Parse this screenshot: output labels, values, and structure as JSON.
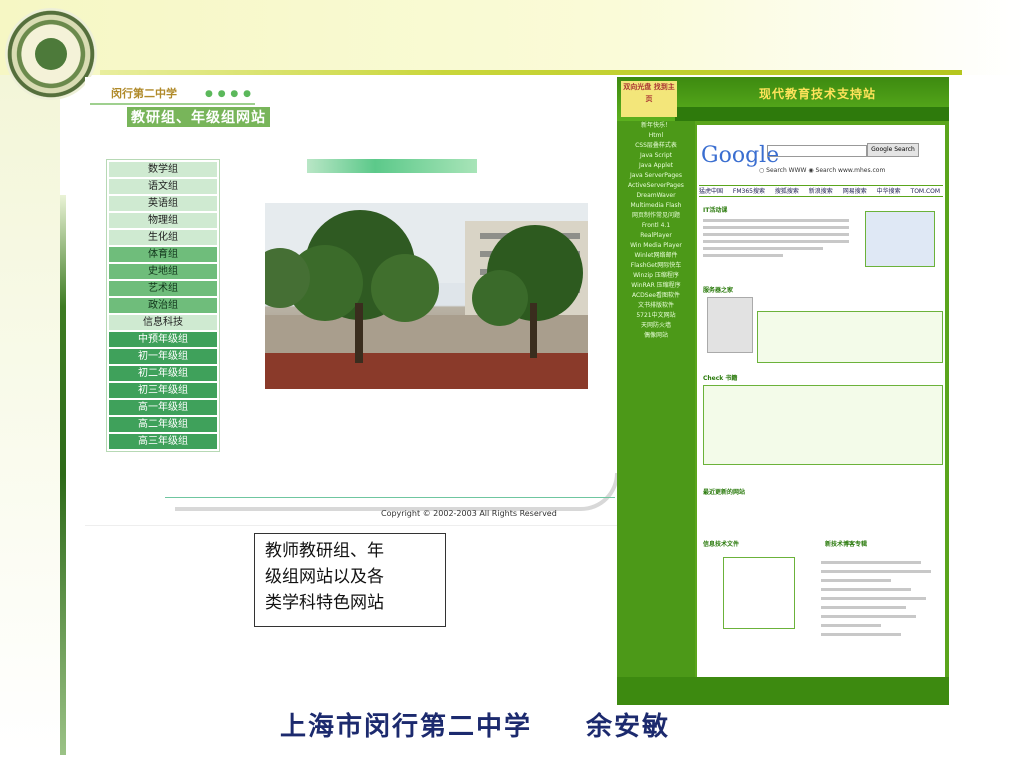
{
  "left_site": {
    "school_name": "闵行第二中学",
    "subtitle": "教研组、年级组网站",
    "menu": [
      "数学组",
      "语文组",
      "英语组",
      "物理组",
      "生化组",
      "体育组",
      "史地组",
      "艺术组",
      "政治组",
      "信息科技",
      "中预年级组",
      "初一年级组",
      "初二年级组",
      "初三年级组",
      "高一年级组",
      "高二年级组",
      "高三年级组"
    ],
    "copyright": "Copyright © 2002-2003 All Rights Reserved"
  },
  "caption": {
    "lines": [
      "教师教研组、年",
      "级组网站以及各",
      "类学科特色网站"
    ]
  },
  "right_site": {
    "title": "现代教育技术支持站",
    "logo_text": "双向光盘 找到主页",
    "google_logo": "Google",
    "search_button": "Google Search",
    "search_radio": "○ Search WWW ◉ Search www.mhes.com",
    "tabs": "猛虎中国 FM365搜索 搜狐搜索 新浪搜索 网易搜索 中华搜索 TOM.COM",
    "side_items": [
      "新年快乐！",
      "Html",
      "CSS层叠样式表",
      "Java Script",
      "Java Applet",
      "Java ServerPages",
      "ActiveServerPages",
      "DreamWaver",
      "Multimedia Flash",
      "网页制作常见问题",
      "Frontl 4.1",
      "RealPlayer",
      "Win Media Player",
      "Winlet网络邮件",
      "FlashGet网际快车",
      "Winzip 压缩程序",
      "WinRAR 压缩程序",
      "ACDSee看图软件",
      "文书排版软件",
      "5721中文网站",
      "天网防火墙",
      "偶像网站"
    ],
    "section_titles": [
      "IT活动课",
      "服务器之家",
      "Check 书籍",
      "最近更新的网站",
      "信息技术文件",
      "新技术博客专辑"
    ]
  },
  "footer": {
    "school": "上海市闵行第二中学",
    "author": "余安敏"
  },
  "colors": {
    "accent_green": "#5aa51c",
    "title_navy": "#1c2a6e",
    "header_band": "#f6f7c4"
  }
}
